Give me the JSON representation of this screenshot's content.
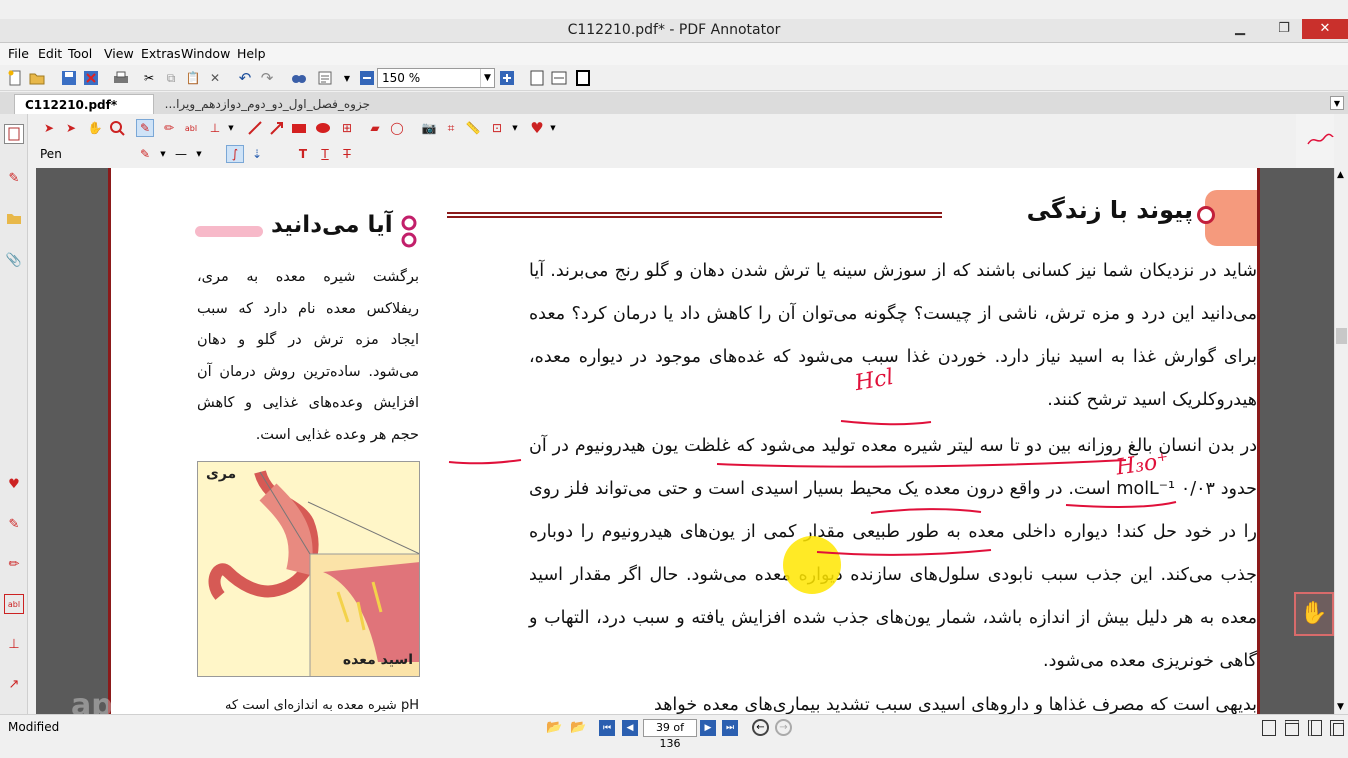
{
  "window": {
    "title": "C112210.pdf* - PDF Annotator",
    "min": "▁",
    "max": "❐",
    "close": "✕"
  },
  "menu": [
    "File",
    "Edit",
    "Tool",
    "View",
    "Extras",
    "Window",
    "Help"
  ],
  "toolbar": {
    "zoom": "150 %"
  },
  "tabs": [
    {
      "label": "C112210.pdf*"
    },
    {
      "label": "جزوه_فصل_اول_دو_دوم_دوازدهم_ویرا..."
    }
  ],
  "annotation_toolbar": {
    "current_tool": "Pen"
  },
  "status": {
    "text": "Modified",
    "page": "39 of 136"
  },
  "document": {
    "heading": "پیوند با زندگی",
    "side_heading": "آیا می‌دانید",
    "paragraph1": "شاید در نزدیکان شما نیز کسانی باشند که از سوزش سینه یا ترش شدن دهان و گلو رنج می‌برند. آیا می‌دانید این درد و مزه ترش، ناشی از چیست؟ چگونه می‌توان آن را کاهش داد یا درمان کرد؟ معده برای گوارش غذا به اسید نیاز دارد. خوردن غذا سبب می‌شود که غده‌های موجود در دیواره معده، هیدروکلریک اسید ترشح کنند.",
    "paragraph2": "در بدن انسان بالغ روزانه بین دو تا سه لیتر شیره معده تولید می‌شود که غلظت یون هیدرونیوم در آن حدود ۰/۰۳ molL⁻¹ است. در واقع درون معده یک محیط بسیار اسیدی است و حتی می‌تواند فلز روی را در خود حل کند! دیواره داخلی معده به طور طبیعی مقدار کمی از یون‌های هیدرونیوم را دوباره جذب می‌کند. این جذب سبب نابودی سلول‌های سازنده دیواره معده می‌شود. حال اگر مقدار اسید معده به هر دلیل بیش از اندازه باشد، شمار یون‌های جذب شده افزایش یافته و سبب درد، التهاب و گاهی خونریزی معده می‌شود.",
    "paragraph3": "بدیهی است که مصرف غذاها و داروهای اسیدی سبب تشدید بیماری‌های معده خواهد",
    "side_text": "برگشت شیره معده به مری، ریفلاکس معده نام دارد که سبب ایجاد مزه ترش در گلو و دهان می‌شود. ساده‌ترین روش درمان آن افزایش وعده‌های غذایی و کاهش حجم هر وعده غذایی است.",
    "side_text2": "pH شیره معده به اندازه‌ای است که",
    "figure_label_top": "مری",
    "figure_label_bottom": "اسید معده",
    "handwritten_1": "Hcl",
    "handwritten_2": "H₃o⁺",
    "watermark": "aparat"
  },
  "colors": {
    "accent": "#8b1a1a",
    "ink": "#e0103a",
    "highlight": "#ffe600"
  }
}
